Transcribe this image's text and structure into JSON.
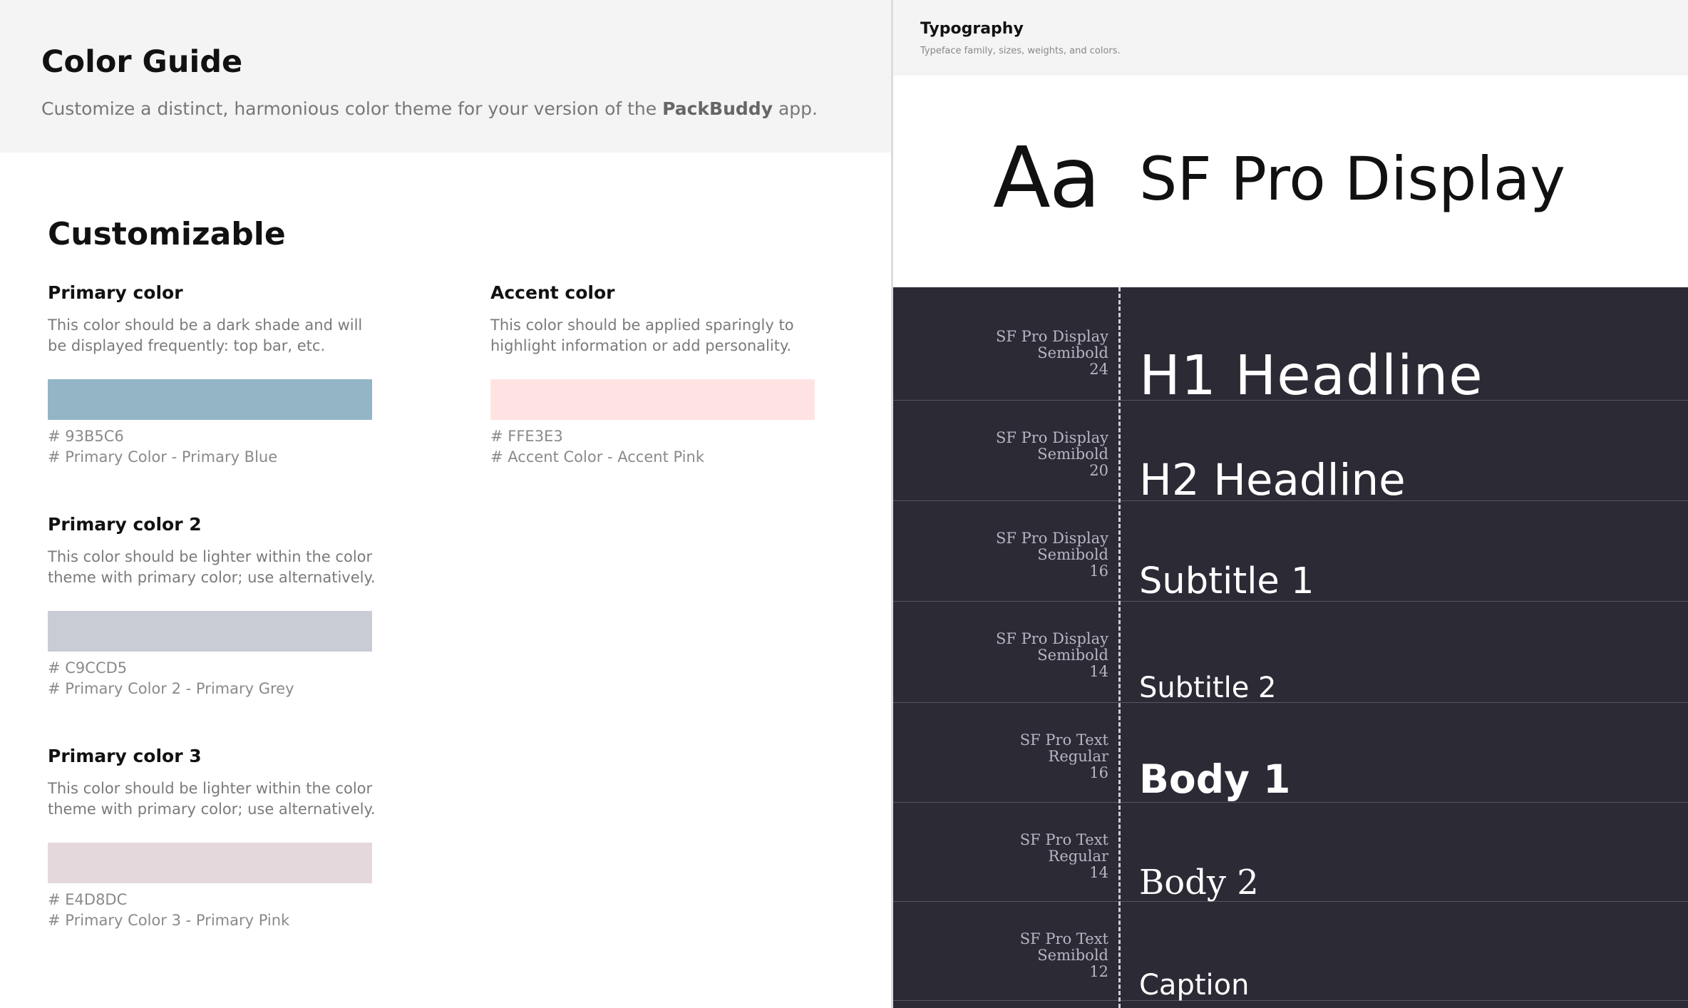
{
  "color_guide": {
    "title": "Color Guide",
    "subtitle_pre": "Customize a distinct, harmonious color theme for your version of the ",
    "subtitle_brand": "PackBuddy",
    "subtitle_post": " app.",
    "section_title": "Customizable",
    "colors": [
      {
        "name": "Primary color",
        "description": "This color should be a dark shade and will be displayed frequently: top bar, etc.",
        "hex": "# 93B5C6",
        "label": "# Primary Color - Primary Blue",
        "swatch": "#93B5C6"
      },
      {
        "name": "Accent color",
        "description": "This color should be applied sparingly to highlight information or add personality.",
        "hex": "# FFE3E3",
        "label": "# Accent Color - Accent Pink",
        "swatch": "#FFE3E3"
      },
      {
        "name": "Primary color 2",
        "description": "This color should be lighter within the color theme with primary color; use alternatively.",
        "hex": "# C9CCD5",
        "label": "# Primary Color 2 - Primary Grey",
        "swatch": "#C9CCD5"
      },
      {
        "name": "Primary color 3",
        "description": "This color should be lighter within the color theme with primary color; use alternatively.",
        "hex": "# E4D8DC",
        "label": "# Primary Color 3 - Primary Pink",
        "swatch": "#E4D8DC"
      }
    ]
  },
  "typography": {
    "title": "Typography",
    "subtitle": "Typeface family, sizes, weights, and colors.",
    "sample_glyphs": "Aa",
    "family_name": "SF Pro Display",
    "styles": [
      {
        "family": "SF Pro Display",
        "weight": "Semibold",
        "size": "24",
        "sample": "H1 Headline"
      },
      {
        "family": "SF Pro Display",
        "weight": "Semibold",
        "size": "20",
        "sample": "H2 Headline"
      },
      {
        "family": "SF Pro Display",
        "weight": "Semibold",
        "size": "16",
        "sample": "Subtitle 1"
      },
      {
        "family": "SF Pro Display",
        "weight": "Semibold",
        "size": "14",
        "sample": "Subtitle 2"
      },
      {
        "family": "SF Pro Text",
        "weight": "Regular",
        "size": "16",
        "sample": "Body 1"
      },
      {
        "family": "SF Pro Text",
        "weight": "Regular",
        "size": "14",
        "sample": "Body 2"
      },
      {
        "family": "SF Pro Text",
        "weight": "Semibold",
        "size": "12",
        "sample": "Caption"
      }
    ]
  }
}
